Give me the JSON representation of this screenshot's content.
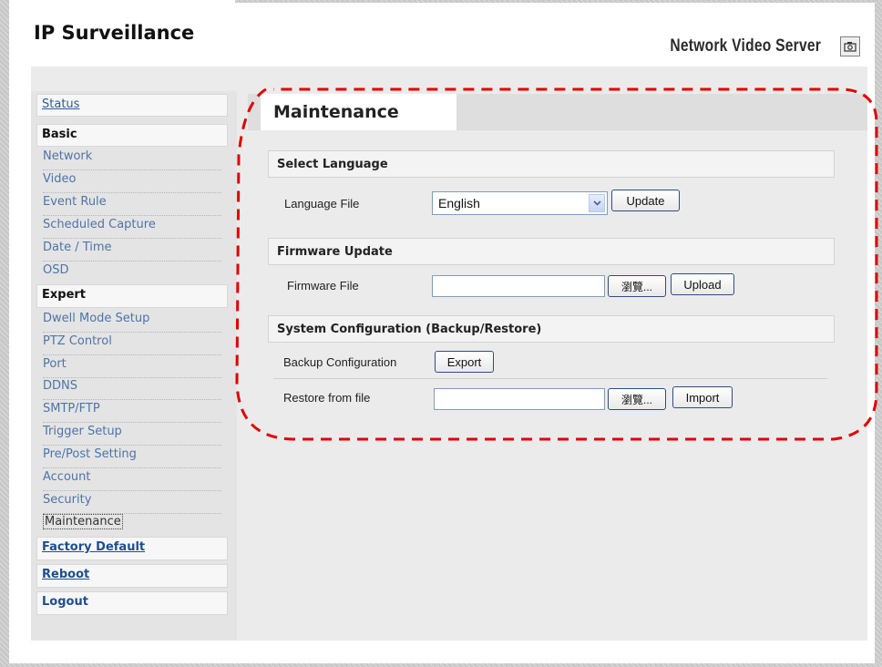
{
  "header": {
    "brand": "IP Surveillance",
    "product": "Network Video Server",
    "snapshot_icon": "camera-icon"
  },
  "sidebar": {
    "status": "Status",
    "basic": "Basic",
    "basic_items": [
      "Network",
      "Video",
      "Event Rule",
      "Scheduled Capture",
      "Date / Time",
      "OSD"
    ],
    "expert": "Expert",
    "expert_items": [
      "Dwell Mode Setup",
      "PTZ Control",
      "Port",
      "DDNS",
      "SMTP/FTP",
      "Trigger Setup",
      "Pre/Post Setting",
      "Account",
      "Security",
      "Maintenance"
    ],
    "factory_default": "Factory Default",
    "reboot": "Reboot",
    "logout": "Logout"
  },
  "main": {
    "title": "Maintenance",
    "language": {
      "heading": "Select Language",
      "label": "Language File",
      "selected": "English",
      "update_button": "Update"
    },
    "firmware": {
      "heading": "Firmware Update",
      "label": "Firmware File",
      "file_value": "",
      "browse_button": "瀏覽...",
      "upload_button": "Upload"
    },
    "config": {
      "heading": "System Configuration (Backup/Restore)",
      "backup_label": "Backup Configuration",
      "export_button": "Export",
      "restore_label": "Restore from file",
      "file_value": "",
      "browse_button": "瀏覽...",
      "import_button": "Import"
    }
  },
  "colors": {
    "link": "#2e5b9b",
    "highlight": "#e00000",
    "button_border": "#2e4e7e"
  }
}
